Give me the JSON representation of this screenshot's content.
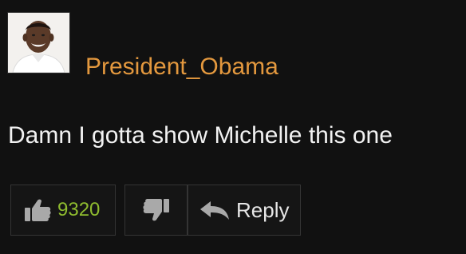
{
  "comment": {
    "username": "President_Obama",
    "text": "Damn I gotta show Michelle this one",
    "avatar_icon": "user-avatar-photo"
  },
  "actions": {
    "like_count": "9320",
    "like_icon": "thumbs-up-icon",
    "dislike_icon": "thumbs-down-icon",
    "reply_icon": "reply-arrow-icon",
    "reply_label": "Reply"
  },
  "colors": {
    "background": "#111111",
    "username": "#e3983e",
    "text": "#f2f2f2",
    "like_count": "#8fbc2f",
    "icon": "#a9a9a9",
    "button_border": "#343434",
    "reply_label": "#e6e6e6"
  }
}
